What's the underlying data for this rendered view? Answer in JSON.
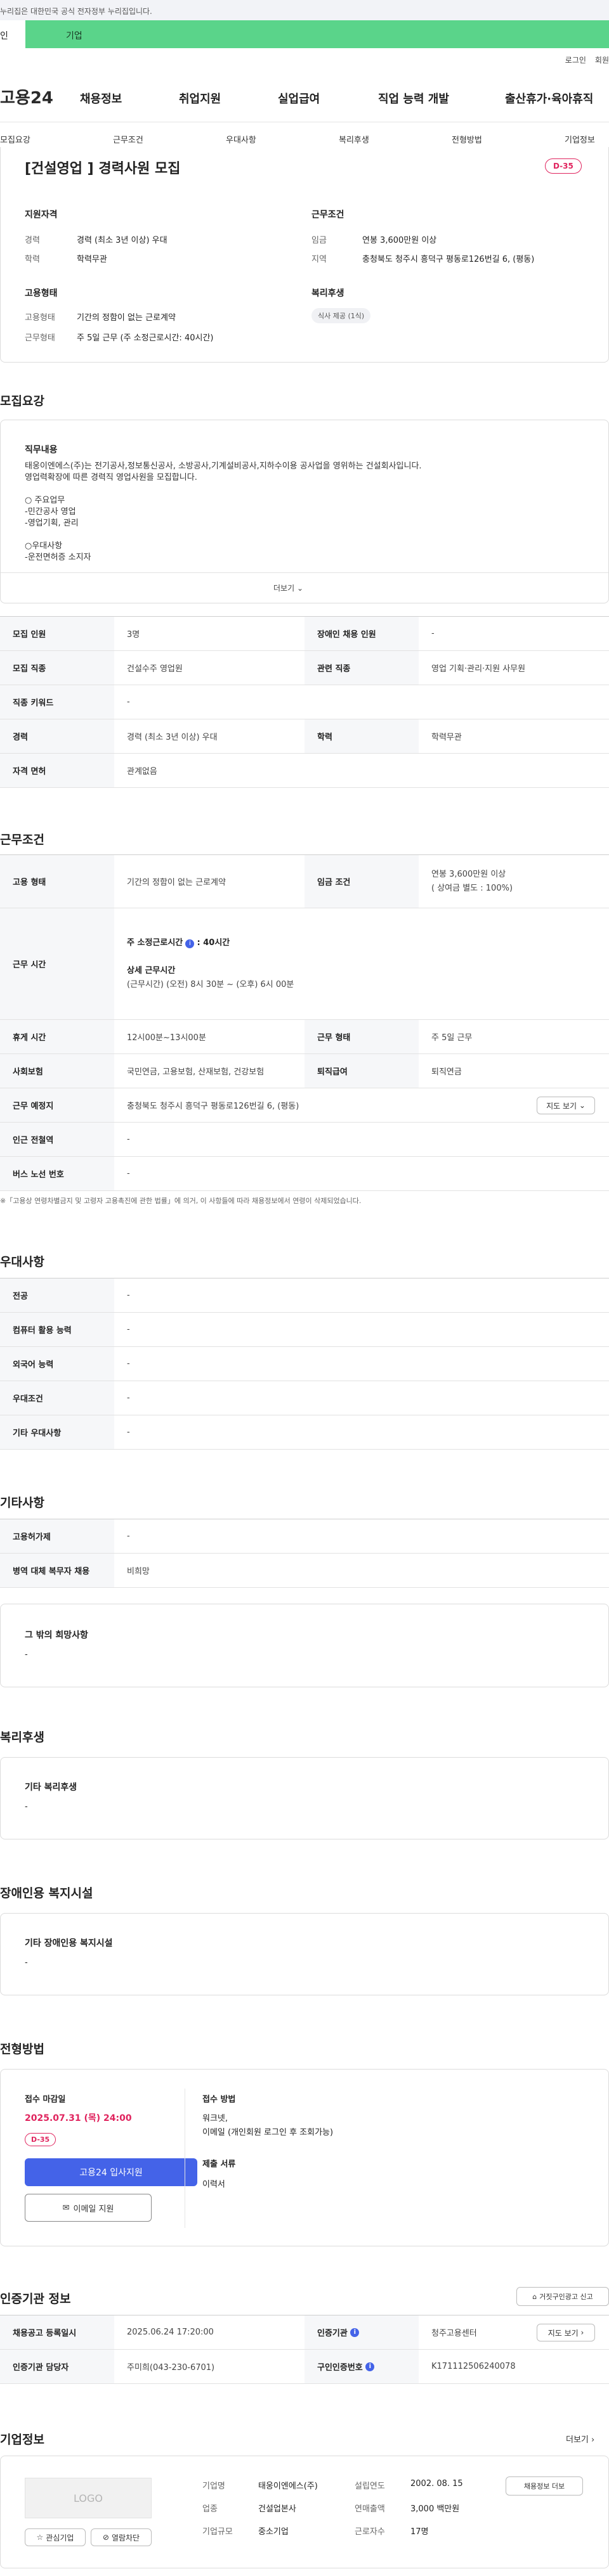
{
  "gov_notice": "누리집은 대한민국 공식 전자정부 누리집입니다.",
  "top_tabs": {
    "person": "인",
    "company": "기업"
  },
  "util": {
    "login": "로그인",
    "join": "회원"
  },
  "logo": "고용24",
  "gnav": [
    "채용정보",
    "취업지원",
    "실업급여",
    "직업 능력 개발",
    "출산휴가·육아휴직"
  ],
  "anchor_nav": [
    "모집요강",
    "근무조건",
    "우대사항",
    "복리후생",
    "전형방법",
    "기업정보"
  ],
  "summary": {
    "title": "[건설영업 ] 경력사원 모집",
    "dday": "D-35",
    "qual_title": "지원자격",
    "career_label": "경력",
    "career_value": "경력 (최소 3년 이상) 우대",
    "edu_label": "학력",
    "edu_value": "학력무관",
    "cond_title": "근무조건",
    "wage_label": "임금",
    "wage_value": "연봉 3,600만원 이상",
    "region_label": "지역",
    "region_value": "충청북도 청주시 흥덕구 평동로126번길 6, (평동)",
    "emp_title": "고용형태",
    "emptype_label": "고용형태",
    "emptype_value": "기간의 정함이 없는 근로계약",
    "worktype_label": "근무형태",
    "worktype_value": "주 5일 근무 (주 소정근로시간: 40시간)",
    "welfare_title": "복리후생",
    "welfare_chip": "식사 제공 (1식)"
  },
  "recruit": {
    "section_title": "모집요강",
    "desc_title": "직무내용",
    "desc_lines": [
      "태웅이엔에스(주)는 전기공사,정보통신공사, 소방공사,기계설비공사,지하수이용 공사업을 영위하는 건설회사입니다.",
      "영업력확장에 따른 경력직 영업사원을 모집합니다.",
      "",
      "○ 주요업무",
      "-민간공사 영업",
      "-영업기획, 관리",
      "",
      "○우대사항",
      "-운전면허증 소지자"
    ],
    "more": "더보기",
    "rows": [
      {
        "k1": "모집 인원",
        "v1": "3명",
        "k2": "장애인 채용 인원",
        "v2": "-"
      },
      {
        "k1": "모집 직종",
        "v1": "건설수주 영업원",
        "k2": "관련 직종",
        "v2": "영업 기획·관리·지원 사무원"
      },
      {
        "k1": "직종 키워드",
        "v1": "-"
      },
      {
        "k1": "경력",
        "v1": "경력 (최소 3년 이상) 우대",
        "k2": "학력",
        "v2": "학력무관"
      },
      {
        "k1": "자격 면허",
        "v1": "관계없음"
      }
    ]
  },
  "conditions": {
    "section_title": "근무조건",
    "emptype_k": "고용 형태",
    "emptype_v": "기간의 정함이 없는 근로계약",
    "wage_k": "임금 조건",
    "wage_v1": "연봉 3,600만원 이상",
    "wage_v2": "( 상여금 별도 : 100%)",
    "hours_k": "근무 시간",
    "hours_weekly": "주 소정근로시간",
    "hours_weekly_val": ": 40시간",
    "hours_detail_title": "상세 근무시간",
    "hours_detail": "(근무시간) (오전) 8시 30분 ~ (오후) 6시 00분",
    "break_k": "휴게 시간",
    "break_v": "12시00분~13시00분",
    "worktype_k": "근무 형태",
    "worktype_v": "주 5일 근무",
    "insurance_k": "사회보험",
    "insurance_v": "국민연금, 고용보험, 산재보험, 건강보험",
    "severance_k": "퇴직급여",
    "severance_v": "퇴직연금",
    "place_k": "근무 예정지",
    "place_v": "충청북도 청주시 흥덕구 평동로126번길 6, (평동)",
    "map_btn": "지도 보기",
    "subway_k": "인근 전철역",
    "subway_v": "-",
    "bus_k": "버스 노선 번호",
    "bus_v": "-",
    "note": "※「고용상 연령차별금지 및 고령자 고용촉진에 관한 법률」에 의거, 이 사항들에 따라 채용정보에서 연령이 삭제되었습니다."
  },
  "preference": {
    "section_title": "우대사항",
    "rows": [
      {
        "k": "전공",
        "v": "-"
      },
      {
        "k": "컴퓨터 활용 능력",
        "v": "-"
      },
      {
        "k": "외국어 능력",
        "v": "-"
      },
      {
        "k": "우대조건",
        "v": "-"
      },
      {
        "k": "기타 우대사항",
        "v": "-"
      }
    ]
  },
  "etc": {
    "section_title": "기타사항",
    "rows": [
      {
        "k": "고용허가제",
        "v": "-"
      },
      {
        "k": "병역 대체 복무자 채용",
        "v": "비희망"
      }
    ],
    "box_title": "그 밖의 희망사항",
    "box_value": "-"
  },
  "welfare": {
    "section_title": "복리후생",
    "box_title": "기타 복리후생",
    "box_value": "-"
  },
  "disability": {
    "section_title": "장애인용 복지시설",
    "box_title": "기타 장애인용 복지시설",
    "box_value": "-"
  },
  "selection": {
    "section_title": "전형방법",
    "deadline_title": "접수 마감일",
    "deadline": "2025.07.31 (목) 24:00",
    "dday": "D-35",
    "apply_btn": "고용24 입사지원",
    "email_btn": "이메일 지원",
    "method_title": "접수 방법",
    "method_lines": [
      "워크넷,",
      "이메일 (개인회원 로그인 후 조회가능)"
    ],
    "docs_title": "제출 서류",
    "docs": "이력서"
  },
  "certification": {
    "section_title": "인증기관 정보",
    "report_btn": "거짓구인광고 신고",
    "reg_k": "채용공고 등록일시",
    "reg_v": "2025.06.24 17:20:00",
    "org_k": "인증기관",
    "org_v": "청주고용센터",
    "org_btn": "지도 보기",
    "staff_k": "인증기관 담당자",
    "staff_v": "주미희(043-230-6701)",
    "job_id_k": "구인인증번호",
    "job_id_v": "K171112506240078"
  },
  "company": {
    "section_title": "기업정보",
    "more": "더보기",
    "logo_placeholder": "LOGO",
    "fav_btn": "관심기업",
    "block_btn": "열람차단",
    "name_k": "기업명",
    "name_v": "태웅이엔에스(주)",
    "found_k": "설립연도",
    "found_v": "2002. 08. 15",
    "industry_k": "업종",
    "industry_v": "건설업본사",
    "revenue_k": "연매출액",
    "revenue_v": "3,000 백만원",
    "size_k": "기업규모",
    "size_v": "중소기업",
    "staff_k": "근로자수",
    "staff_v": "17명",
    "jobs_btn": "채용정보 더보"
  },
  "colors": {
    "accent": "#4463e8",
    "green": "#5ad48a",
    "dday": "#e0245e"
  }
}
